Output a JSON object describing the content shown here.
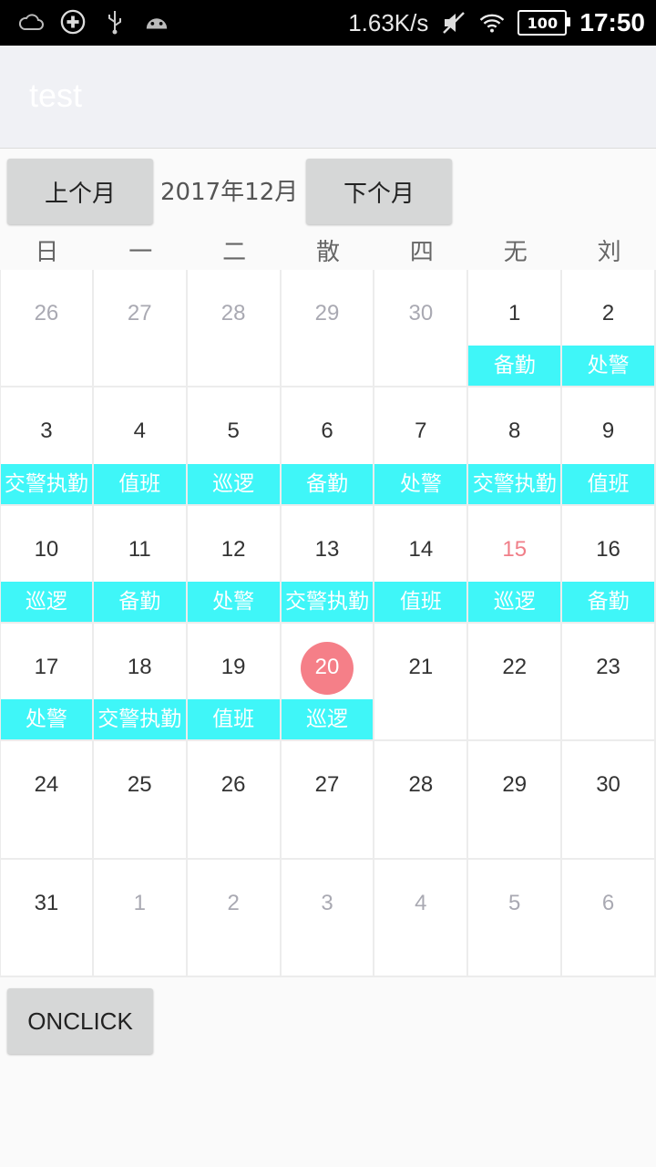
{
  "status_bar": {
    "speed": "1.63K/s",
    "battery": "100",
    "time": "17:50",
    "icons": [
      "cloud-icon",
      "plus-circle-icon",
      "usb-icon",
      "android-icon",
      "mute-icon",
      "wifi-icon",
      "battery-icon"
    ]
  },
  "app_bar": {
    "title": "test"
  },
  "nav": {
    "prev_label": "上个月",
    "month_label": "2017年12月",
    "next_label": "下个月"
  },
  "weekdays": [
    "日",
    "一",
    "二",
    "散",
    "四",
    "无",
    "刘"
  ],
  "days": [
    {
      "d": "26",
      "state": "other",
      "tag": ""
    },
    {
      "d": "27",
      "state": "other",
      "tag": ""
    },
    {
      "d": "28",
      "state": "other",
      "tag": ""
    },
    {
      "d": "29",
      "state": "other",
      "tag": ""
    },
    {
      "d": "30",
      "state": "other",
      "tag": ""
    },
    {
      "d": "1",
      "state": "normal",
      "tag": "备勤"
    },
    {
      "d": "2",
      "state": "normal",
      "tag": "处警"
    },
    {
      "d": "3",
      "state": "normal",
      "tag": "交警执勤"
    },
    {
      "d": "4",
      "state": "normal",
      "tag": "值班"
    },
    {
      "d": "5",
      "state": "normal",
      "tag": "巡逻"
    },
    {
      "d": "6",
      "state": "normal",
      "tag": "备勤"
    },
    {
      "d": "7",
      "state": "normal",
      "tag": "处警"
    },
    {
      "d": "8",
      "state": "normal",
      "tag": "交警执勤"
    },
    {
      "d": "9",
      "state": "normal",
      "tag": "值班"
    },
    {
      "d": "10",
      "state": "normal",
      "tag": "巡逻"
    },
    {
      "d": "11",
      "state": "normal",
      "tag": "备勤"
    },
    {
      "d": "12",
      "state": "normal",
      "tag": "处警"
    },
    {
      "d": "13",
      "state": "normal",
      "tag": "交警执勤"
    },
    {
      "d": "14",
      "state": "normal",
      "tag": "值班"
    },
    {
      "d": "15",
      "state": "red",
      "tag": "巡逻"
    },
    {
      "d": "16",
      "state": "normal",
      "tag": "备勤"
    },
    {
      "d": "17",
      "state": "normal",
      "tag": "处警"
    },
    {
      "d": "18",
      "state": "normal",
      "tag": "交警执勤"
    },
    {
      "d": "19",
      "state": "normal",
      "tag": "值班"
    },
    {
      "d": "20",
      "state": "today",
      "tag": "巡逻"
    },
    {
      "d": "21",
      "state": "normal",
      "tag": ""
    },
    {
      "d": "22",
      "state": "normal",
      "tag": ""
    },
    {
      "d": "23",
      "state": "normal",
      "tag": ""
    },
    {
      "d": "24",
      "state": "normal",
      "tag": ""
    },
    {
      "d": "25",
      "state": "normal",
      "tag": ""
    },
    {
      "d": "26",
      "state": "normal",
      "tag": ""
    },
    {
      "d": "27",
      "state": "normal",
      "tag": ""
    },
    {
      "d": "28",
      "state": "normal",
      "tag": ""
    },
    {
      "d": "29",
      "state": "normal",
      "tag": ""
    },
    {
      "d": "30",
      "state": "normal",
      "tag": ""
    },
    {
      "d": "31",
      "state": "normal",
      "tag": ""
    },
    {
      "d": "1",
      "state": "other",
      "tag": ""
    },
    {
      "d": "2",
      "state": "other",
      "tag": ""
    },
    {
      "d": "3",
      "state": "other",
      "tag": ""
    },
    {
      "d": "4",
      "state": "other",
      "tag": ""
    },
    {
      "d": "5",
      "state": "other",
      "tag": ""
    },
    {
      "d": "6",
      "state": "other",
      "tag": ""
    }
  ],
  "footer": {
    "button_label": "ONCLICK"
  },
  "colors": {
    "tag_bg": "#3ff6f8",
    "today_bg": "#f57f88",
    "highlight_text": "#f07e88"
  }
}
